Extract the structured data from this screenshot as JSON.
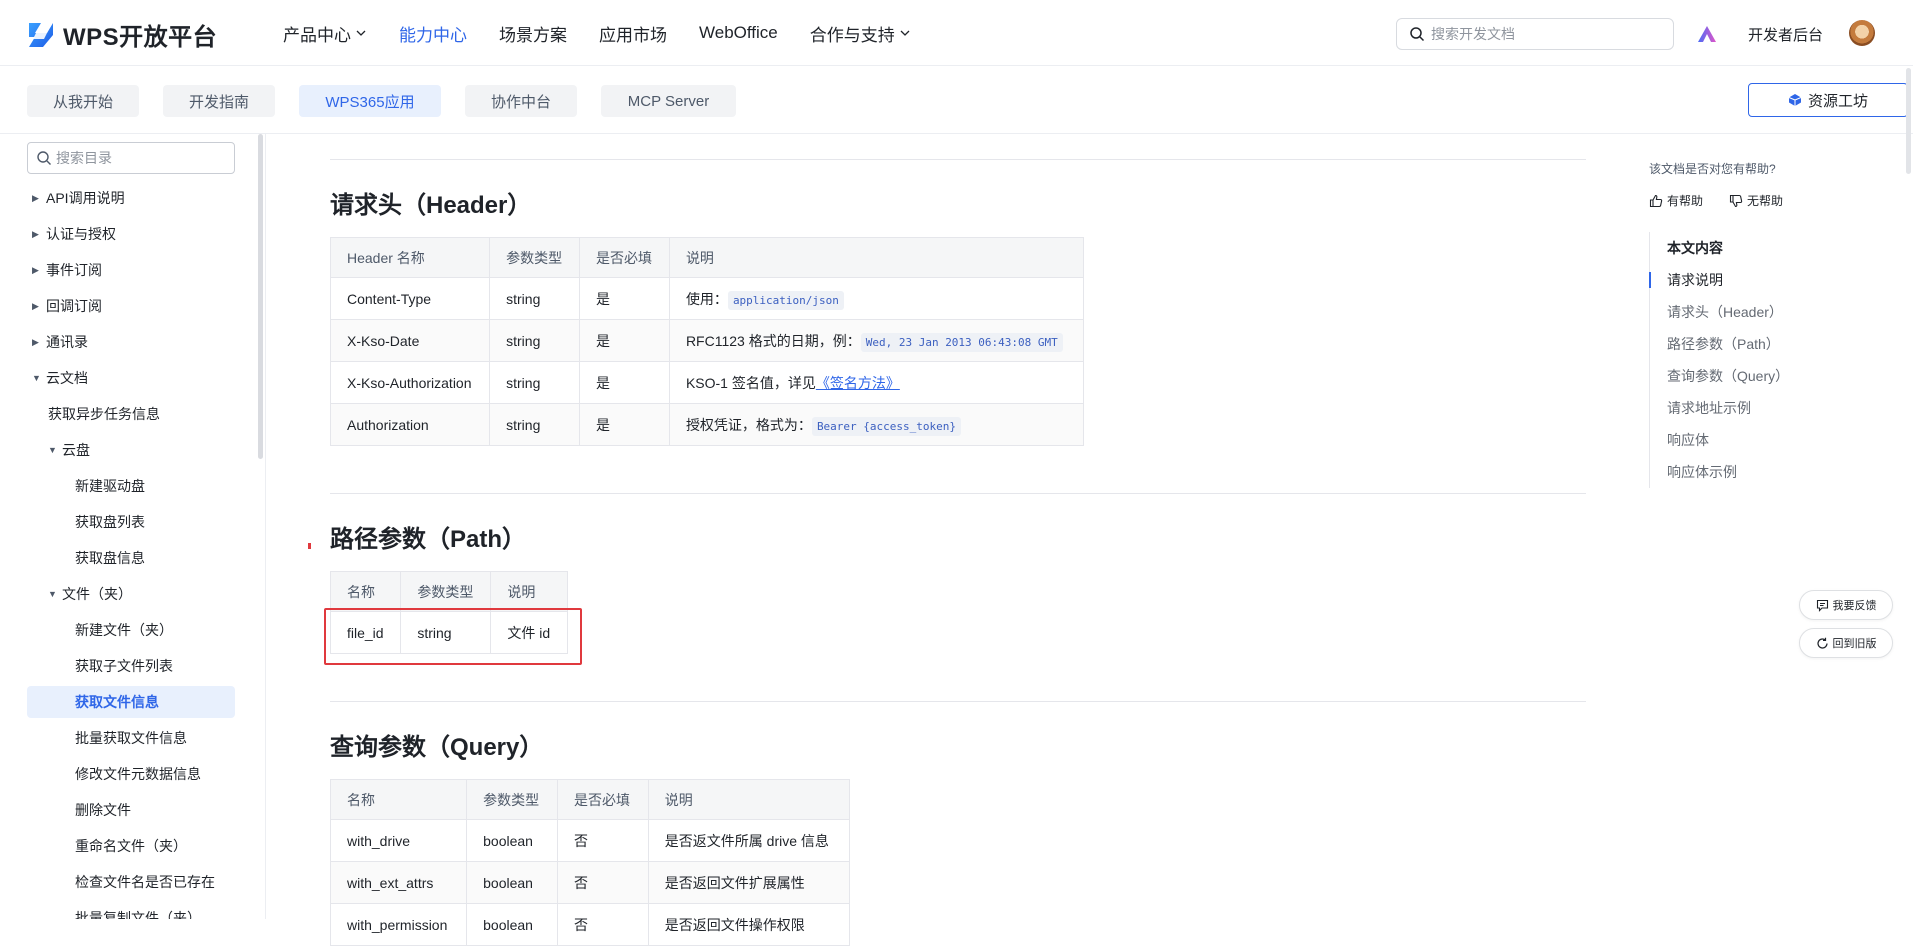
{
  "brand": {
    "name": "WPS开放平台"
  },
  "nav": [
    {
      "label": "产品中心",
      "has_menu": true,
      "active": false
    },
    {
      "label": "能力中心",
      "has_menu": false,
      "active": true
    },
    {
      "label": "场景方案",
      "has_menu": false,
      "active": false
    },
    {
      "label": "应用市场",
      "has_menu": false,
      "active": false
    },
    {
      "label": "WebOffice",
      "has_menu": false,
      "active": false
    },
    {
      "label": "合作与支持",
      "has_menu": true,
      "active": false
    }
  ],
  "search": {
    "placeholder": "搜索开发文档"
  },
  "header_right": {
    "dev_console": "开发者后台"
  },
  "subnav": {
    "tabs": [
      "从我开始",
      "开发指南",
      "WPS365应用",
      "协作中台",
      "MCP Server"
    ],
    "active_index": 2,
    "resource_button": "资源工坊"
  },
  "sidebar": {
    "search_placeholder": "搜索目录",
    "items": [
      {
        "label": "API调用说明",
        "level": 0,
        "arrow": "right"
      },
      {
        "label": "认证与授权",
        "level": 0,
        "arrow": "right"
      },
      {
        "label": "事件订阅",
        "level": 0,
        "arrow": "right"
      },
      {
        "label": "回调订阅",
        "level": 0,
        "arrow": "right"
      },
      {
        "label": "通讯录",
        "level": 0,
        "arrow": "right"
      },
      {
        "label": "云文档",
        "level": 0,
        "arrow": "down"
      },
      {
        "label": "获取异步任务信息",
        "level": 1,
        "arrow": ""
      },
      {
        "label": "云盘",
        "level": 1,
        "arrow": "down"
      },
      {
        "label": "新建驱动盘",
        "level": 2,
        "arrow": ""
      },
      {
        "label": "获取盘列表",
        "level": 2,
        "arrow": ""
      },
      {
        "label": "获取盘信息",
        "level": 2,
        "arrow": ""
      },
      {
        "label": "文件（夹）",
        "level": 1,
        "arrow": "down"
      },
      {
        "label": "新建文件（夹）",
        "level": 2,
        "arrow": ""
      },
      {
        "label": "获取子文件列表",
        "level": 2,
        "arrow": ""
      },
      {
        "label": "获取文件信息",
        "level": 2,
        "arrow": "",
        "active": true
      },
      {
        "label": "批量获取文件信息",
        "level": 2,
        "arrow": ""
      },
      {
        "label": "修改文件元数据信息",
        "level": 2,
        "arrow": ""
      },
      {
        "label": "删除文件",
        "level": 2,
        "arrow": ""
      },
      {
        "label": "重命名文件（夹）",
        "level": 2,
        "arrow": ""
      },
      {
        "label": "检查文件名是否已存在",
        "level": 2,
        "arrow": ""
      },
      {
        "label": "批量复制文件（夹）",
        "level": 2,
        "arrow": ""
      }
    ]
  },
  "content": {
    "header_section": {
      "title": "请求头（Header）",
      "columns": [
        "Header 名称",
        "参数类型",
        "是否必填",
        "说明"
      ],
      "rows": [
        {
          "name": "Content-Type",
          "type": "string",
          "required": "是",
          "desc_text": "使用：",
          "desc_code": "application/json",
          "desc_link": ""
        },
        {
          "name": "X-Kso-Date",
          "type": "string",
          "required": "是",
          "desc_text": "RFC1123 格式的日期，例：",
          "desc_code": "Wed, 23 Jan 2013 06:43:08 GMT",
          "desc_link": ""
        },
        {
          "name": "X-Kso-Authorization",
          "type": "string",
          "required": "是",
          "desc_text": "KSO-1 签名值，详见",
          "desc_code": "",
          "desc_link": "《签名方法》"
        },
        {
          "name": "Authorization",
          "type": "string",
          "required": "是",
          "desc_text": "授权凭证，格式为：",
          "desc_code": "Bearer {access_token}",
          "desc_link": ""
        }
      ]
    },
    "path_section": {
      "title": "路径参数（Path）",
      "columns": [
        "名称",
        "参数类型",
        "说明"
      ],
      "rows": [
        {
          "name": "file_id",
          "type": "string",
          "desc": "文件 id"
        }
      ]
    },
    "query_section": {
      "title": "查询参数（Query）",
      "columns": [
        "名称",
        "参数类型",
        "是否必填",
        "说明"
      ],
      "rows": [
        {
          "name": "with_drive",
          "type": "boolean",
          "required": "否",
          "desc": "是否返文件所属 drive 信息"
        },
        {
          "name": "with_ext_attrs",
          "type": "boolean",
          "required": "否",
          "desc": "是否返回文件扩展属性"
        },
        {
          "name": "with_permission",
          "type": "boolean",
          "required": "否",
          "desc": "是否返回文件操作权限"
        }
      ]
    }
  },
  "right_panel": {
    "helpful_question": "该文档是否对您有帮助?",
    "helpful_yes": "有帮助",
    "helpful_no": "无帮助",
    "toc_title": "本文内容",
    "toc": [
      "请求说明",
      "请求头（Header）",
      "路径参数（Path）",
      "查询参数（Query）",
      "请求地址示例",
      "响应体",
      "响应体示例"
    ],
    "toc_current_index": 0,
    "feedback_button": "我要反馈",
    "old_version_button": "回到旧版"
  },
  "colors": {
    "accent": "#2f66e8",
    "highlight_box": "#e0393e"
  }
}
